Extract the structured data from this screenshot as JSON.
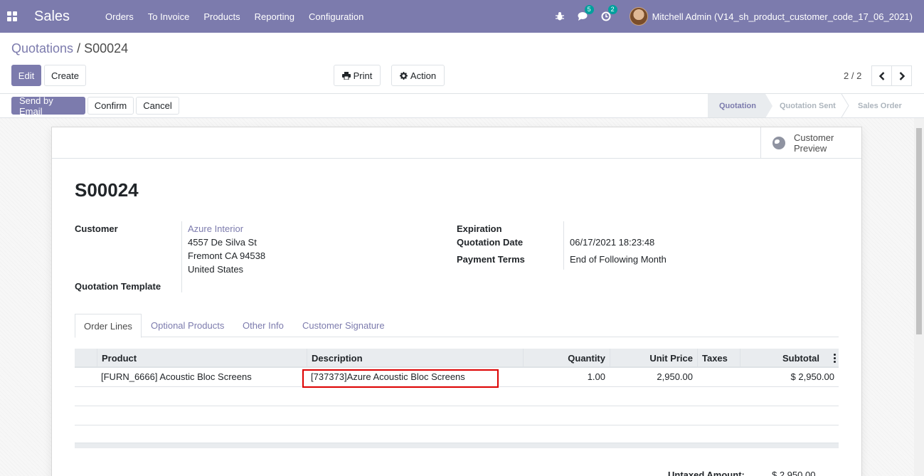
{
  "navbar": {
    "app_name": "Sales",
    "menu": [
      "Orders",
      "To Invoice",
      "Products",
      "Reporting",
      "Configuration"
    ],
    "messages_count": "5",
    "activities_count": "2",
    "user": "Mitchell Admin (V14_sh_product_customer_code_17_06_2021)"
  },
  "breadcrumb": {
    "parent": "Quotations",
    "separator": "/",
    "current": "S00024"
  },
  "control": {
    "edit": "Edit",
    "create": "Create",
    "print": "Print",
    "action": "Action",
    "pager": "2 / 2"
  },
  "statusbar": {
    "send_email": "Send by Email",
    "confirm": "Confirm",
    "cancel": "Cancel",
    "stages": [
      "Quotation",
      "Quotation Sent",
      "Sales Order"
    ],
    "active_stage": "Quotation"
  },
  "form": {
    "preview_button": "Customer Preview",
    "name": "S00024",
    "customer_label": "Customer",
    "customer_name": "Azure Interior",
    "address": [
      "4557 De Silva St",
      "Fremont CA 94538",
      "United States"
    ],
    "template_label": "Quotation Template",
    "expiration_label": "Expiration",
    "quotation_date_label": "Quotation Date",
    "quotation_date": "06/17/2021 18:23:48",
    "payment_terms_label": "Payment Terms",
    "payment_terms": "End of Following Month"
  },
  "tabs": [
    "Order Lines",
    "Optional Products",
    "Other Info",
    "Customer Signature"
  ],
  "table": {
    "headers": [
      "Product",
      "Description",
      "Quantity",
      "Unit Price",
      "Taxes",
      "Subtotal"
    ],
    "rows": [
      {
        "product": "[FURN_6666] Acoustic Bloc Screens",
        "description": "[737373]Azure Acoustic Bloc Screens",
        "quantity": "1.00",
        "unit_price": "2,950.00",
        "taxes": "",
        "subtotal": "$ 2,950.00"
      }
    ]
  },
  "totals": {
    "untaxed_label": "Untaxed Amount:",
    "untaxed_value": "$ 2,950.00"
  },
  "colors": {
    "brand": "#7c7bad",
    "highlight": "#dd0000",
    "badge": "#00a09d"
  }
}
